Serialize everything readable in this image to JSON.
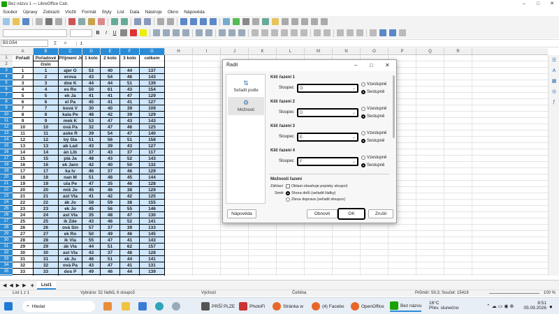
{
  "window": {
    "title": "Bez názvu 1 — LibreOffice Calc",
    "controls": [
      "–",
      "□",
      "✕"
    ]
  },
  "menu": [
    "Soubor",
    "Úpravy",
    "Zobrazit",
    "Vložit",
    "Formát",
    "Styly",
    "List",
    "Data",
    "Nástroje",
    "Okno",
    "Nápověda"
  ],
  "formula": {
    "namebox": "B3:G54",
    "fx": "Σ",
    "eq": "=",
    "content": "1"
  },
  "columns": [
    "A",
    "B",
    "C",
    "D",
    "E",
    "F",
    "G",
    "H",
    "I",
    "J",
    "K",
    "L",
    "M",
    "N",
    "O",
    "P",
    "Q",
    "R"
  ],
  "rows": [
    "1",
    "2",
    "3",
    "4",
    "5",
    "6",
    "7",
    "8",
    "9",
    "10",
    "11",
    "12",
    "13",
    "14",
    "15",
    "16",
    "17",
    "18",
    "19",
    "20",
    "21",
    "22",
    "23",
    "24",
    "25",
    "26",
    "27",
    "28",
    "29",
    "30",
    "31",
    "32",
    "33",
    "34",
    "35",
    "36"
  ],
  "header": {
    "A": "Pořadí",
    "B1": "Pořadové",
    "B2": "číslo",
    "C": "Příjmení Jm",
    "D": "1 kolo",
    "E": "2 kolo",
    "F": "3 kolo",
    "G": "celkem"
  },
  "table": [
    [
      "1",
      "1",
      "ajer O",
      "53",
      "40",
      "44",
      "137"
    ],
    [
      "2",
      "2",
      "erova",
      "43",
      "54",
      "46",
      "143"
    ],
    [
      "3",
      "3",
      "dne K",
      "44",
      "44",
      "51",
      "139"
    ],
    [
      "4",
      "4",
      "es Ro",
      "50",
      "61",
      "43",
      "154"
    ],
    [
      "5",
      "5",
      "ek Ja",
      "41",
      "41",
      "47",
      "129"
    ],
    [
      "6",
      "6",
      "el Pa",
      "45",
      "41",
      "41",
      "127"
    ],
    [
      "7",
      "7",
      "ková V",
      "30",
      "40",
      "39",
      "109"
    ],
    [
      "8",
      "8",
      "kala Pe",
      "48",
      "42",
      "39",
      "129"
    ],
    [
      "9",
      "9",
      "mek K",
      "53",
      "47",
      "43",
      "143"
    ],
    [
      "10",
      "10",
      "ová Pa",
      "32",
      "47",
      "46",
      "125"
    ],
    [
      "11",
      "11",
      "aske R",
      "39",
      "54",
      "47",
      "140"
    ],
    [
      "12",
      "12",
      "bý Sla",
      "51",
      "56",
      "51",
      "158"
    ],
    [
      "13",
      "13",
      "ab Lad",
      "43",
      "39",
      "43",
      "127"
    ],
    [
      "14",
      "14",
      "án Lib",
      "37",
      "43",
      "37",
      "117"
    ],
    [
      "15",
      "15",
      "plá Ja",
      "48",
      "43",
      "52",
      "143"
    ],
    [
      "16",
      "16",
      "ek Jaro",
      "42",
      "40",
      "50",
      "132"
    ],
    [
      "17",
      "17",
      "ka Iv",
      "46",
      "37",
      "46",
      "129"
    ],
    [
      "18",
      "18",
      "nan M",
      "51",
      "48",
      "45",
      "144"
    ],
    [
      "19",
      "19",
      "ula Pe",
      "47",
      "35",
      "46",
      "128"
    ],
    [
      "20",
      "20",
      "miš Jo",
      "45",
      "46",
      "38",
      "129"
    ],
    [
      "21",
      "21",
      "ast Vla",
      "41",
      "42",
      "42",
      "125"
    ],
    [
      "22",
      "22",
      "ák Jo",
      "58",
      "59",
      "38",
      "155"
    ],
    [
      "23",
      "23",
      "ek Jo",
      "45",
      "56",
      "55",
      "146"
    ],
    [
      "24",
      "24",
      "ast Vla",
      "35",
      "48",
      "47",
      "130"
    ],
    [
      "25",
      "25",
      "ik Zde",
      "43",
      "46",
      "52",
      "141"
    ],
    [
      "26",
      "26",
      "ová Sin",
      "57",
      "37",
      "39",
      "133"
    ],
    [
      "27",
      "27",
      "ek Ro",
      "50",
      "49",
      "46",
      "145"
    ],
    [
      "28",
      "28",
      "ik Vla",
      "55",
      "47",
      "41",
      "143"
    ],
    [
      "29",
      "29",
      "ák Vla",
      "44",
      "51",
      "62",
      "157"
    ],
    [
      "30",
      "30",
      "ast Vla",
      "43",
      "37",
      "48",
      "128"
    ],
    [
      "31",
      "31",
      "ek Ju",
      "46",
      "51",
      "44",
      "141"
    ],
    [
      "32",
      "32",
      "ová Pa",
      "43",
      "47",
      "41",
      "131"
    ],
    [
      "33",
      "33",
      "dos P",
      "49",
      "46",
      "44",
      "139"
    ],
    [
      "34",
      "34",
      "ka Ma",
      "57",
      "46",
      "44",
      "147"
    ]
  ],
  "sheet": {
    "tab": "List1"
  },
  "status": {
    "sheet": "List 1 z 1",
    "selection": "Vybráno: 52 řádků, 6 sloupců",
    "style": "Výchozí",
    "lang": "Čeština",
    "sum": "Průměr: 59,3; Součet: 15418",
    "zoom": "100 %"
  },
  "dialog": {
    "title": "Řadit",
    "nav": [
      "Seřadit podle",
      "Možnosti"
    ],
    "keys": [
      {
        "label": "Klíč řazení 1",
        "col": "G",
        "asc": "Vzestupně",
        "desc": "Sestupně"
      },
      {
        "label": "Klíč řazení 2",
        "col": "D",
        "asc": "Vzestupně",
        "desc": "Sestupně"
      },
      {
        "label": "Klíč řazení 3",
        "col": "E",
        "asc": "Vzestupně",
        "desc": "Sestupně"
      },
      {
        "label": "Klíč řazení 4",
        "col": "F",
        "asc": "Vzestupně",
        "desc": "Sestupně"
      }
    ],
    "column_label": "Sloupec",
    "options_title": "Možnosti řazení",
    "header_label": "Záhlaví",
    "header_opt": "Oblast obsahuje popisky sloupců",
    "dir_label": "Směr",
    "dir_opt1": "Shora dolů (seřadit řádky)",
    "dir_opt2": "Zleva doprava (seřadit sloupce)",
    "btn_help": "Nápověda",
    "btn_reset": "Obnovit",
    "btn_ok": "OK",
    "btn_cancel": "Zrušit"
  },
  "taskbar": {
    "search": "Hledat",
    "items": [
      "PRŠÍ PLZE",
      "PhotoFi",
      "Stránka w",
      "(4) Facebo",
      "OpenOffice",
      "Bez názvu"
    ],
    "weather_temp": "16°C",
    "weather": "Přev. slunečno",
    "time": "8:51",
    "date": "05.09.2026"
  }
}
